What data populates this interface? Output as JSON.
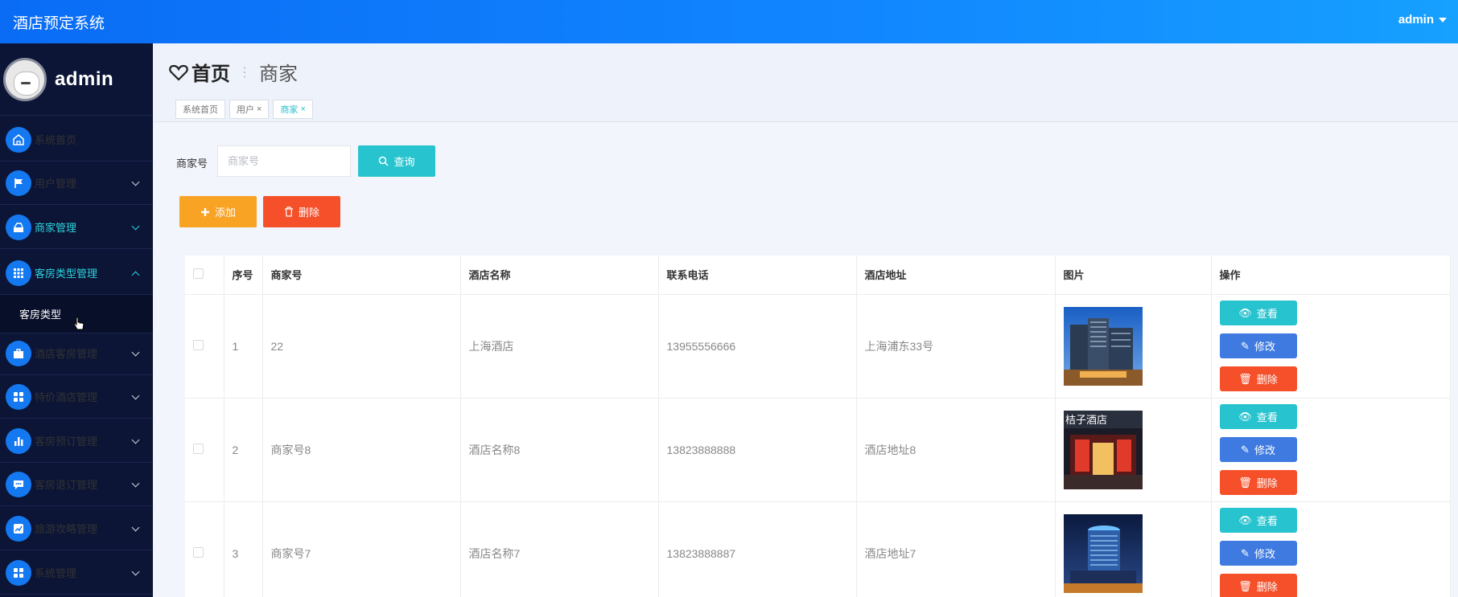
{
  "header": {
    "app_title": "酒店预定系统",
    "user": "admin"
  },
  "sidebar": {
    "profile_name": "admin",
    "items": [
      {
        "label": "系统首页",
        "icon": "home-icon"
      },
      {
        "label": "用户管理",
        "icon": "flag-icon"
      },
      {
        "label": "商家管理",
        "icon": "store-icon"
      },
      {
        "label": "客房类型管理",
        "icon": "grid-icon"
      },
      {
        "label": "酒店客房管理",
        "icon": "briefcase-icon"
      },
      {
        "label": "特价酒店管理",
        "icon": "apps-icon"
      },
      {
        "label": "客房预订管理",
        "icon": "bar-chart-icon"
      },
      {
        "label": "客房退订管理",
        "icon": "chat-icon"
      },
      {
        "label": "旅游攻略管理",
        "icon": "trend-icon"
      },
      {
        "label": "系统管理",
        "icon": "apps-icon"
      }
    ],
    "submenu": {
      "label": "客房类型"
    }
  },
  "breadcrumb": {
    "home": "首页",
    "current": "商家"
  },
  "tabs": [
    {
      "label": "系统首页"
    },
    {
      "label": "用户"
    },
    {
      "label": "商家"
    }
  ],
  "search": {
    "label": "商家号",
    "placeholder": "商家号",
    "button": "查询"
  },
  "actions": {
    "add": "添加",
    "delete": "删除"
  },
  "table": {
    "headers": [
      "序号",
      "商家号",
      "酒店名称",
      "联系电话",
      "酒店地址",
      "图片",
      "操作"
    ],
    "rows": [
      {
        "index": "1",
        "merchant_no": "22",
        "hotel": "上海酒店",
        "phone": "13955556666",
        "address": "上海浦东33号",
        "image": "hotel-tower-photo"
      },
      {
        "index": "2",
        "merchant_no": "商家号8",
        "hotel": "酒店名称8",
        "phone": "13823888888",
        "address": "酒店地址8",
        "image": "hotel-entrance-photo"
      },
      {
        "index": "3",
        "merchant_no": "商家号7",
        "hotel": "酒店名称7",
        "phone": "13823888887",
        "address": "酒店地址7",
        "image": "hotel-night-photo"
      }
    ],
    "op_labels": {
      "view": "查看",
      "edit": "修改",
      "delete": "删除"
    }
  },
  "photo_sign_text": "桔子酒店"
}
